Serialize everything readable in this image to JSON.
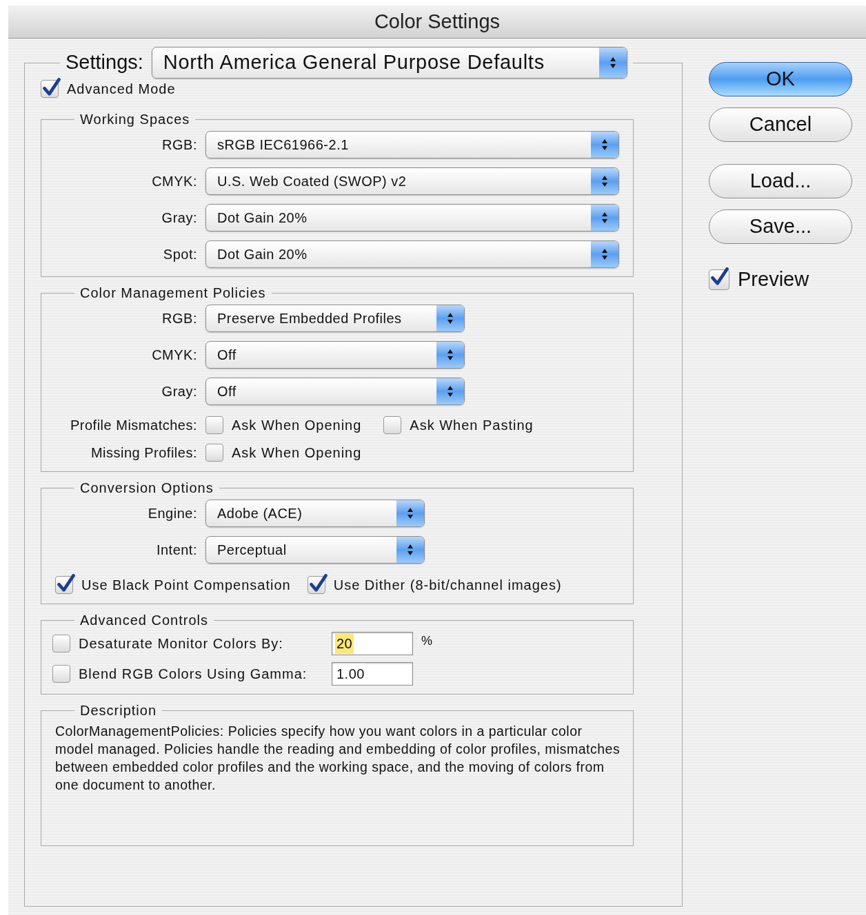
{
  "window": {
    "title": "Color Settings"
  },
  "settings": {
    "label": "Settings:",
    "value": "North America General Purpose Defaults"
  },
  "advanced_mode": {
    "label": "Advanced Mode",
    "checked": true
  },
  "sections": [
    {
      "kind": "wide",
      "title": "Working Spaces",
      "rows": [
        {
          "label": "RGB:",
          "value": "sRGB IEC61966-2.1"
        },
        {
          "label": "CMYK:",
          "value": "U.S. Web Coated (SWOP) v2"
        },
        {
          "label": "Gray:",
          "value": "Dot Gain 20%"
        },
        {
          "label": "Spot:",
          "value": "Dot Gain 20%"
        }
      ]
    },
    {
      "kind": "medium",
      "title": "Color Management Policies",
      "rows": [
        {
          "label": "RGB:",
          "value": "Preserve Embedded Profiles"
        },
        {
          "label": "CMYK:",
          "value": "Off"
        },
        {
          "label": "Gray:",
          "value": "Off"
        }
      ],
      "checkbox_rows": [
        {
          "label": "Profile Mismatches:",
          "options": [
            {
              "label": "Ask When Opening",
              "checked": false
            },
            {
              "label": "Ask When Pasting",
              "checked": false
            }
          ]
        },
        {
          "label": "Missing Profiles:",
          "options": [
            {
              "label": "Ask When Opening",
              "checked": false
            }
          ]
        }
      ]
    },
    {
      "kind": "narrow",
      "title": "Conversion Options",
      "rows": [
        {
          "label": "Engine:",
          "value": "Adobe (ACE)"
        },
        {
          "label": "Intent:",
          "value": "Perceptual"
        }
      ],
      "options": [
        {
          "label": "Use Black Point Compensation",
          "checked": true
        },
        {
          "label": "Use Dither (8-bit/channel images)",
          "checked": true
        }
      ]
    },
    {
      "kind": "fields",
      "title": "Advanced Controls",
      "fields": [
        {
          "label": "Desaturate Monitor Colors By:",
          "checked": false,
          "value": "20",
          "highlighted": true,
          "unit": "%"
        },
        {
          "label": "Blend RGB Colors Using Gamma:",
          "checked": false,
          "value": "1.00",
          "highlighted": false
        }
      ]
    },
    {
      "kind": "text",
      "title": "Description",
      "text": "ColorManagementPolicies: Policies specify how you want colors in a particular color model managed.  Policies handle the reading and embedding of color profiles, mismatches between embedded color profiles and the working space, and the moving of colors from one document to another."
    }
  ],
  "buttons": [
    {
      "label": "OK",
      "default": true
    },
    {
      "label": "Cancel",
      "default": false
    },
    {
      "label": "Load...",
      "default": false
    },
    {
      "label": "Save...",
      "default": false
    }
  ],
  "preview": {
    "label": "Preview",
    "checked": true
  }
}
